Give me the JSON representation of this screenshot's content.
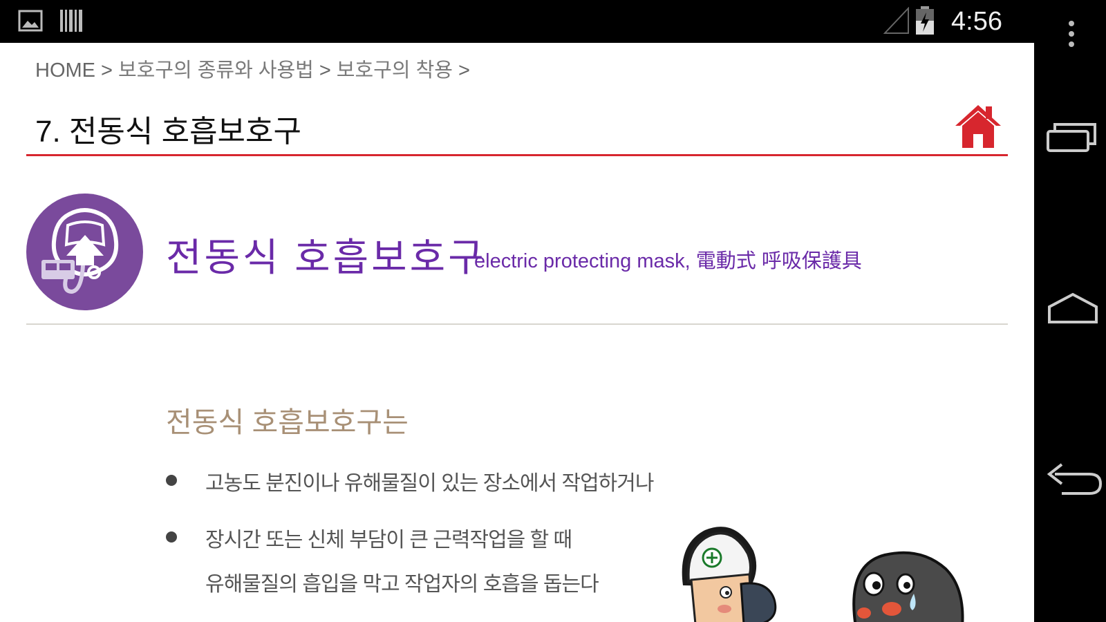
{
  "status_bar": {
    "time": "4:56",
    "icons": [
      "gallery-notification-icon",
      "barcode-notification-icon",
      "signal-icon",
      "battery-charging-icon"
    ]
  },
  "breadcrumb": {
    "items": [
      "HOME",
      "보호구의 종류와 사용법",
      "보호구의 착용"
    ],
    "separator": ">"
  },
  "page_title": "7. 전동식 호흡보호구",
  "hero": {
    "title_ko": "전동식 호흡보호구",
    "title_en": "electric protecting mask, 電動式 呼吸保護具",
    "icon": "respirator-mask-icon"
  },
  "intro": {
    "heading": "전동식 호흡보호구는",
    "bullets": [
      "고농도 분진이나 유해물질이 있는 장소에서 작업하거나",
      "장시간 또는 신체 부담이 큰 근력작업을 할 때"
    ],
    "continuation": "유해물질의 흡입을 막고 작업자의 호흡을 돕는다"
  },
  "nav_bar": {
    "buttons": [
      "overflow-menu-icon",
      "recent-apps-icon",
      "home-nav-icon",
      "back-icon"
    ]
  },
  "colors": {
    "accent_red": "#d7262e",
    "purple": "#6a2aa8",
    "circle_purple": "#7a4a9c",
    "heading_tan": "#a89076"
  }
}
